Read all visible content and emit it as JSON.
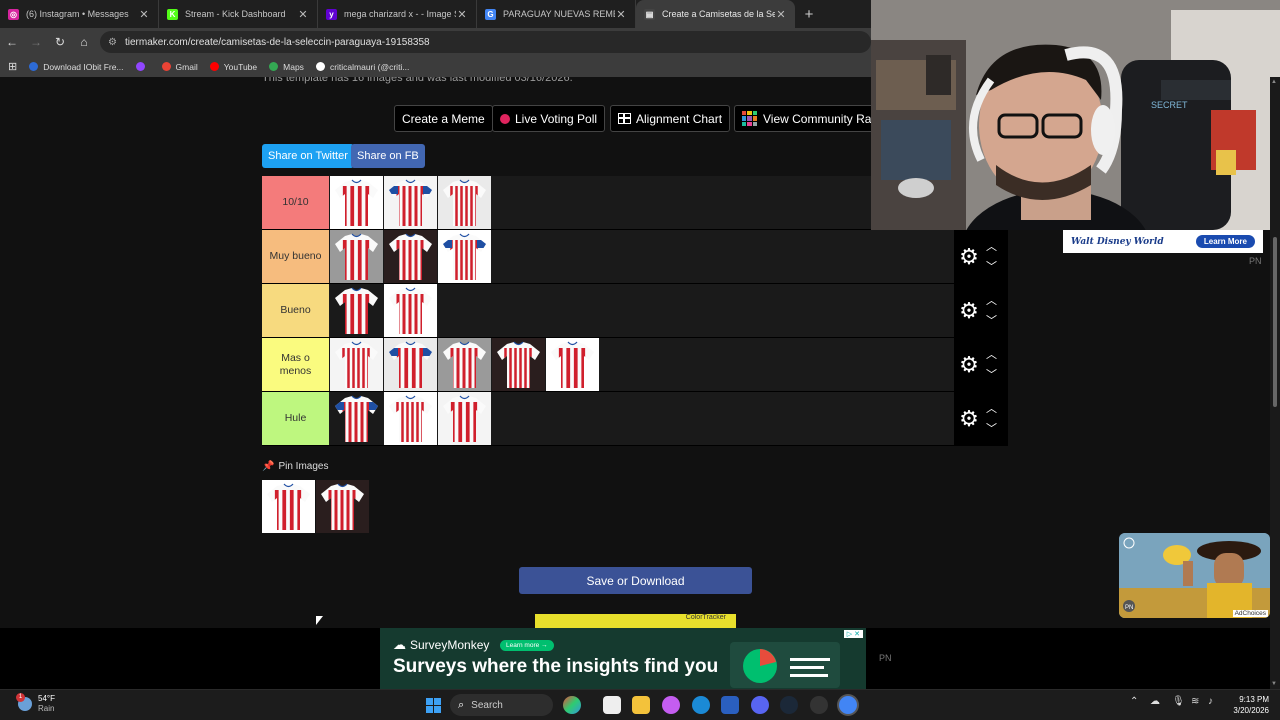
{
  "browser": {
    "tabs": [
      {
        "title": "(6) Instagram • Messages",
        "favicon_color": "#d6249f",
        "favicon_glyph": "◎"
      },
      {
        "title": "Stream - Kick Dashboard",
        "favicon_color": "#53fc18",
        "favicon_glyph": "K"
      },
      {
        "title": "mega charizard x - - Image Sea",
        "favicon_color": "#6001d2",
        "favicon_glyph": "y"
      },
      {
        "title": "PARAGUAY NUEVAS REMERAS",
        "favicon_color": "#4285f4",
        "favicon_glyph": "G"
      },
      {
        "title": "Create a Camisetas de la Selecc",
        "favicon_color": "#444444",
        "favicon_glyph": "▤"
      }
    ],
    "url": "tiermaker.com/create/camisetas-de-la-seleccin-paraguaya-19158358",
    "bookmarks": [
      {
        "label": "Download IObit Fre...",
        "color": "#2d6bd6"
      },
      {
        "label": "",
        "color": "#9146ff"
      },
      {
        "label": "Gmail",
        "color": "#ea4335"
      },
      {
        "label": "YouTube",
        "color": "#ff0000"
      },
      {
        "label": "Maps",
        "color": "#34a853"
      },
      {
        "label": "criticalmauri (@criti...",
        "color": "#ffffff"
      }
    ]
  },
  "page": {
    "top_line": "This template has 16 images and was last modified 03/16/2026.",
    "actions": {
      "create_meme": "Create a Meme",
      "live_voting": "Live Voting Poll",
      "alignment": "Alignment Chart",
      "community_rank": "View Community Rank"
    },
    "share": {
      "twitter": "Share on Twitter",
      "facebook": "Share on FB"
    },
    "tiers": [
      {
        "label": "10/10",
        "color": "#f47b7b",
        "items": 3
      },
      {
        "label": "Muy bueno",
        "color": "#f6bc7e",
        "items": 3
      },
      {
        "label": "Bueno",
        "color": "#f7da7f",
        "items": 2
      },
      {
        "label": "Mas o menos",
        "color": "#fafb7f",
        "items": 5
      },
      {
        "label": "Hule",
        "color": "#bef77f",
        "items": 3
      }
    ],
    "pin_label": "Pin Images",
    "save_button": "Save or Download",
    "small_ad": "ColorTracker"
  },
  "ads": {
    "disney_brand": "Walt Disney World",
    "disney_cta": "Learn More",
    "pn": "PN",
    "adchoices": "AdChoices",
    "survey_brand": "SurveyMonkey",
    "survey_cta": "Learn more →",
    "survey_headline": "Surveys where the insights find you"
  },
  "taskbar": {
    "temp": "54°F",
    "condition": "Rain",
    "badge": "1",
    "search": "Search",
    "time": "9:13 PM",
    "date": "3/20/2026"
  }
}
